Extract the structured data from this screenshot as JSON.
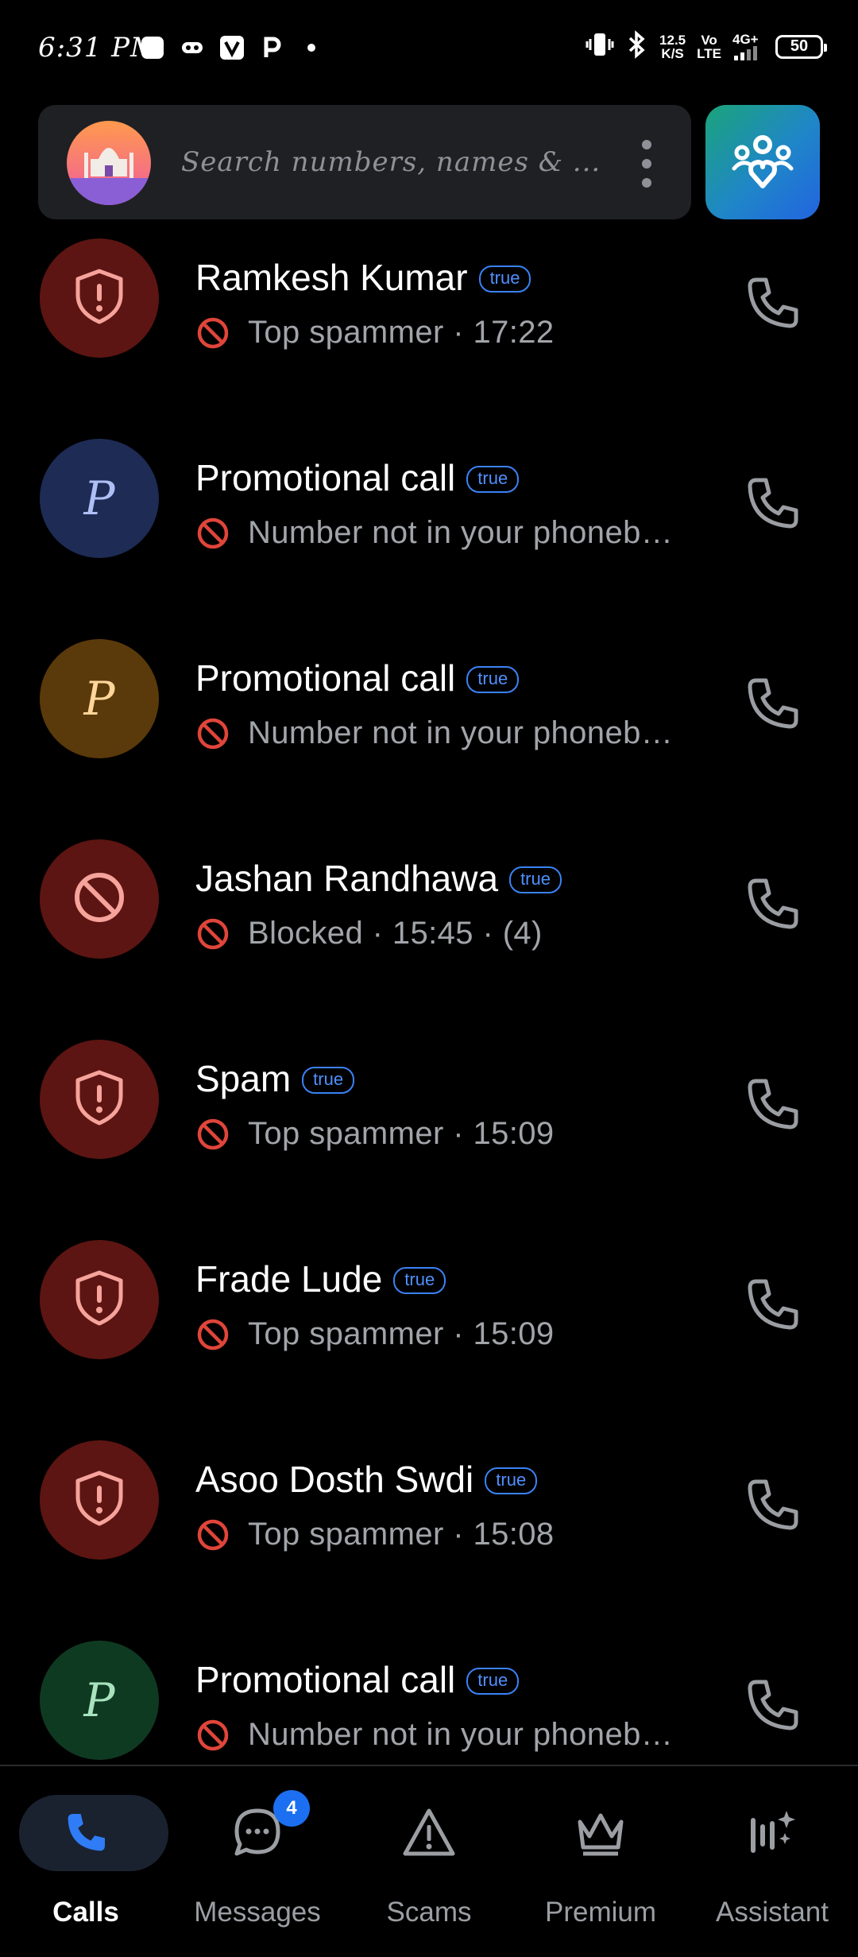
{
  "status_bar": {
    "time": "6:31 PM",
    "app_icons": [
      "square-app-icon",
      "gamepad-icon",
      "v-app-icon",
      "p-app-icon",
      "dot-icon"
    ],
    "network_speed": "12.5",
    "network_speed_unit": "K/S",
    "volte_top": "Vo",
    "volte_bottom": "LTE",
    "network_type": "4G+",
    "battery": "50"
  },
  "search": {
    "placeholder": "Search numbers, names & ..."
  },
  "calls": [
    {
      "name": "Ramkesh Kumar",
      "badge": "true",
      "detail": "Top spammer · 17:22",
      "avatar": "shield",
      "avatar_color": "#5c1512",
      "avatar_fg": "#f6a39c"
    },
    {
      "name": "Promotional call",
      "badge": "true",
      "detail": "Number not in your phonebook",
      "avatar": "letter",
      "letter": "P",
      "avatar_color": "#1d2b55",
      "avatar_fg": "#aebff5"
    },
    {
      "name": "Promotional call",
      "badge": "true",
      "detail": "Number not in your phonebook",
      "avatar": "letter",
      "letter": "P",
      "avatar_color": "#5a3a0a",
      "avatar_fg": "#ffd59a"
    },
    {
      "name": "Jashan Randhawa",
      "badge": "true",
      "detail": "Blocked · 15:45 · (4)",
      "avatar": "blocked",
      "avatar_color": "#5c1512",
      "avatar_fg": "#f6a39c"
    },
    {
      "name": "Spam",
      "badge": "true",
      "detail": "Top spammer · 15:09",
      "avatar": "shield",
      "avatar_color": "#5c1512",
      "avatar_fg": "#f6a39c"
    },
    {
      "name": "Frade Lude",
      "badge": "true",
      "detail": "Top spammer · 15:09",
      "avatar": "shield",
      "avatar_color": "#5c1512",
      "avatar_fg": "#f6a39c"
    },
    {
      "name": "Asoo Dosth Swdi",
      "badge": "true",
      "detail": "Top spammer · 15:08",
      "avatar": "shield",
      "avatar_color": "#5c1512",
      "avatar_fg": "#f6a39c"
    },
    {
      "name": "Promotional call",
      "badge": "true",
      "detail": "Number not in your phonebook",
      "avatar": "letter",
      "letter": "P",
      "avatar_color": "#0f3a22",
      "avatar_fg": "#a8e3be"
    }
  ],
  "nav": {
    "items": [
      {
        "label": "Calls",
        "icon": "phone-icon",
        "active": true
      },
      {
        "label": "Messages",
        "icon": "chat-bubble-icon",
        "badge": "4"
      },
      {
        "label": "Scams",
        "icon": "warning-triangle-icon"
      },
      {
        "label": "Premium",
        "icon": "crown-icon"
      },
      {
        "label": "Assistant",
        "icon": "voice-assistant-icon"
      }
    ]
  },
  "colors": {
    "accent_blue": "#1b6ff0",
    "spam_red": "#e0453a",
    "badge_blue": "#3b82f6"
  }
}
